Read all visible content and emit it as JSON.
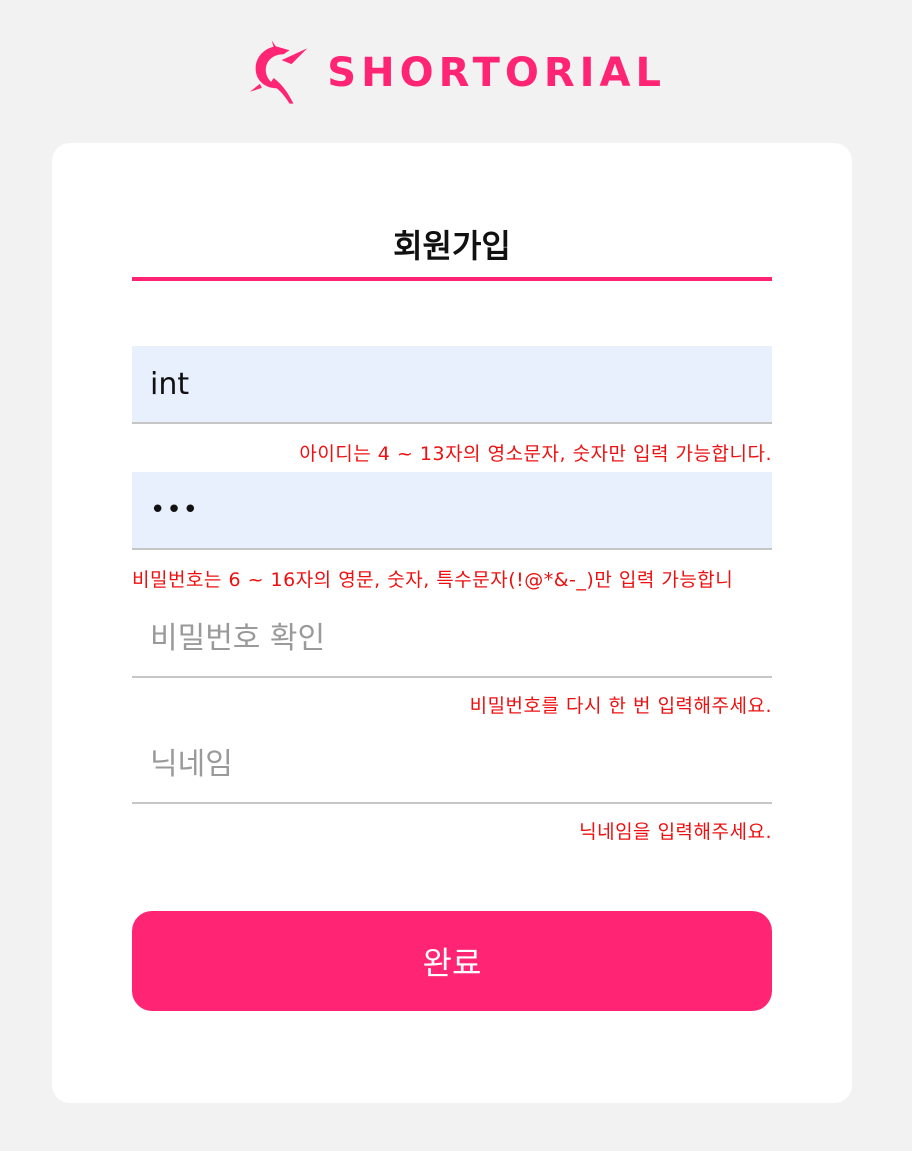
{
  "brand": {
    "logo_icon": "dancer-logo-icon",
    "name": "SHORTORIAL",
    "color": "#ff2474"
  },
  "form": {
    "title": "회원가입",
    "fields": [
      {
        "name": "id",
        "value": "int",
        "placeholder": "",
        "hint": "아이디는 4 ~ 13자의 영소문자, 숫자만 입력 가능합니다."
      },
      {
        "name": "password",
        "value": "•••",
        "placeholder": "",
        "hint": "비밀번호는 6 ~ 16자의 영문, 숫자, 특수문자(!@*&-_)만 입력 가능합니"
      },
      {
        "name": "password-confirm",
        "value": "",
        "placeholder": "비밀번호 확인",
        "hint": "비밀번호를 다시 한 번 입력해주세요."
      },
      {
        "name": "nickname",
        "value": "",
        "placeholder": "닉네임",
        "hint": "닉네임을 입력해주세요."
      }
    ],
    "submit_label": "완료"
  },
  "colors": {
    "accent": "#ff2474",
    "error": "#ee1010",
    "autofill": "#e8f0fd",
    "background": "#f2f2f2"
  }
}
